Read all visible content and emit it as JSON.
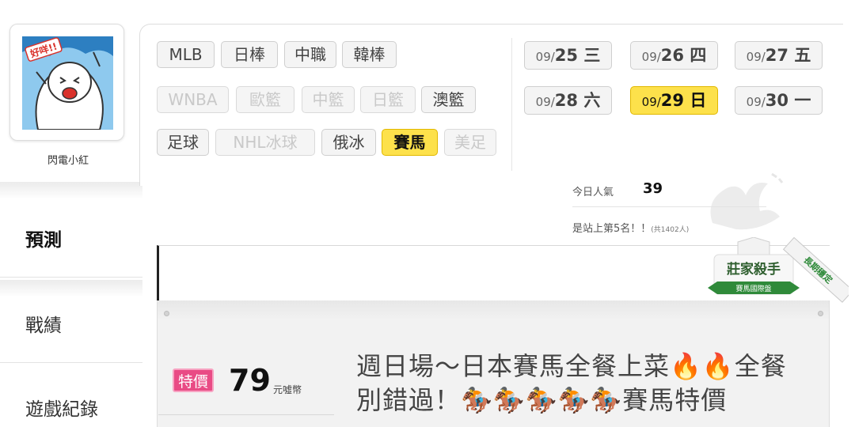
{
  "sidebar": {
    "avatar_sticker_text": "好咩!!",
    "username": "閃電小紅",
    "items": [
      {
        "label": "預測",
        "active": true
      },
      {
        "label": "戰績",
        "active": false
      },
      {
        "label": "遊戲紀錄",
        "active": false
      }
    ]
  },
  "leagues": [
    {
      "label": "MLB",
      "state": "normal"
    },
    {
      "label": "日棒",
      "state": "normal"
    },
    {
      "label": "中職",
      "state": "normal"
    },
    {
      "label": "韓棒",
      "state": "normal"
    },
    {
      "label": "WNBA",
      "state": "disabled"
    },
    {
      "label": "歐籃",
      "state": "disabled"
    },
    {
      "label": "中籃",
      "state": "disabled"
    },
    {
      "label": "日籃",
      "state": "disabled"
    },
    {
      "label": "澳籃",
      "state": "normal"
    },
    {
      "label": "足球",
      "state": "normal"
    },
    {
      "label": "NHL冰球",
      "state": "disabled"
    },
    {
      "label": "俄冰",
      "state": "normal"
    },
    {
      "label": "賽馬",
      "state": "active"
    },
    {
      "label": "美足",
      "state": "disabled"
    }
  ],
  "dates": [
    {
      "prefix": "09/",
      "day": "25 三",
      "active": false
    },
    {
      "prefix": "09/",
      "day": "26 四",
      "active": false
    },
    {
      "prefix": "09/",
      "day": "27 五",
      "active": false
    },
    {
      "prefix": "09/",
      "day": "28 六",
      "active": false
    },
    {
      "prefix": "09/",
      "day": "29 日",
      "active": true
    },
    {
      "prefix": "09/",
      "day": "30 一",
      "active": false
    }
  ],
  "popularity": {
    "label": "今日人氣",
    "value": "39"
  },
  "rank": {
    "text": "是站上第5名！！",
    "note": "(共1402人)"
  },
  "badge": {
    "title": "莊家殺手",
    "subtitle": "賽馬國際盤",
    "ribbon": "長期穩定"
  },
  "offer": {
    "special_label": "特價",
    "price": "79",
    "currency": "元噓幣",
    "headline": "週日場～日本賽馬全餐上菜🔥🔥全餐別錯過！🏇🏇🏇🏇🏇賽馬特價"
  },
  "colors": {
    "active_yellow": "#fde14b",
    "special_pink": "#e94b85",
    "badge_green": "#2f8a3a"
  }
}
